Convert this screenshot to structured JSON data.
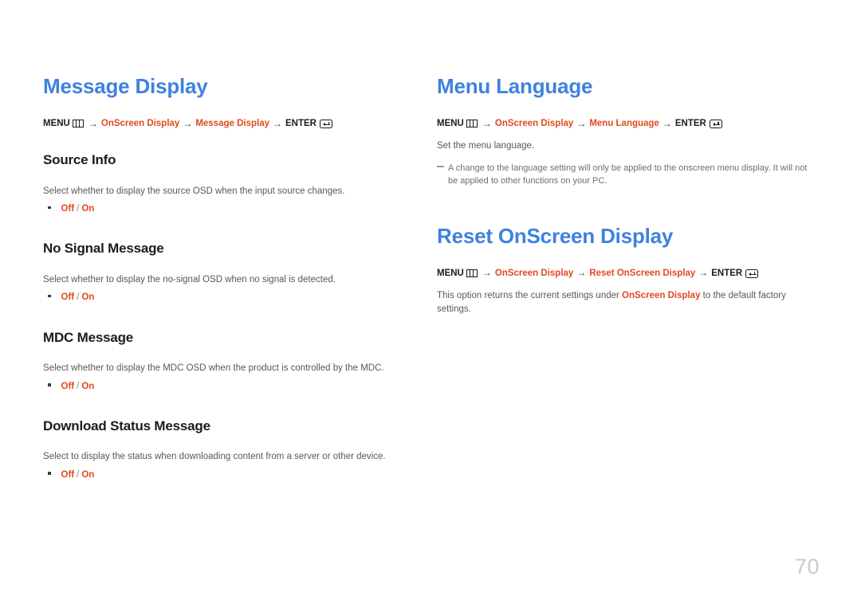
{
  "page": {
    "number": "70",
    "accent_blue": "#3d82e0",
    "accent_orange": "#e0491f",
    "body_gray": "#585858"
  },
  "icons": {
    "menu": "menu-icon",
    "enter": "enter-return-icon",
    "arrow": "→",
    "bullet": "square-bullet-icon",
    "note_dash": "em-dash-icon"
  },
  "left_column": {
    "chapter_title": "Message Display",
    "breadcrumb": {
      "menu_label": "MENU",
      "arrow": "→",
      "link1": "OnScreen Display",
      "link2": "Message Display",
      "enter_label": "ENTER"
    },
    "sections": [
      {
        "title": "Source Info",
        "description": "Select whether to display the source OSD when the input source changes.",
        "option_off": "Off",
        "option_sep": "/",
        "option_on": "On"
      },
      {
        "title": "No Signal Message",
        "description": "Select whether to display the no-signal OSD when no signal is detected.",
        "option_off": "Off",
        "option_sep": "/",
        "option_on": "On"
      },
      {
        "title": "MDC Message",
        "description": "Select whether to display the MDC OSD when the product is controlled by the MDC.",
        "option_off": "Off",
        "option_sep": "/",
        "option_on": "On"
      },
      {
        "title": "Download Status Message",
        "description": "Select to display the status when downloading content from a server or other device.",
        "option_off": "Off",
        "option_sep": "/",
        "option_on": "On"
      }
    ]
  },
  "right_column": {
    "block1": {
      "chapter_title": "Menu Language",
      "breadcrumb": {
        "menu_label": "MENU",
        "arrow": "→",
        "link1": "OnScreen Display",
        "link2": "Menu Language",
        "enter_label": "ENTER"
      },
      "description": "Set the menu language.",
      "note": "A change to the language setting will only be applied to the onscreen menu display. It will not be applied to other functions on your PC."
    },
    "block2": {
      "chapter_title": "Reset OnScreen Display",
      "breadcrumb": {
        "menu_label": "MENU",
        "arrow": "→",
        "link1": "OnScreen Display",
        "link2": "Reset OnScreen Display",
        "enter_label": "ENTER"
      },
      "description_part1": "This option returns the current settings under ",
      "description_highlight": "OnScreen Display",
      "description_part2": " to the default factory settings."
    }
  }
}
